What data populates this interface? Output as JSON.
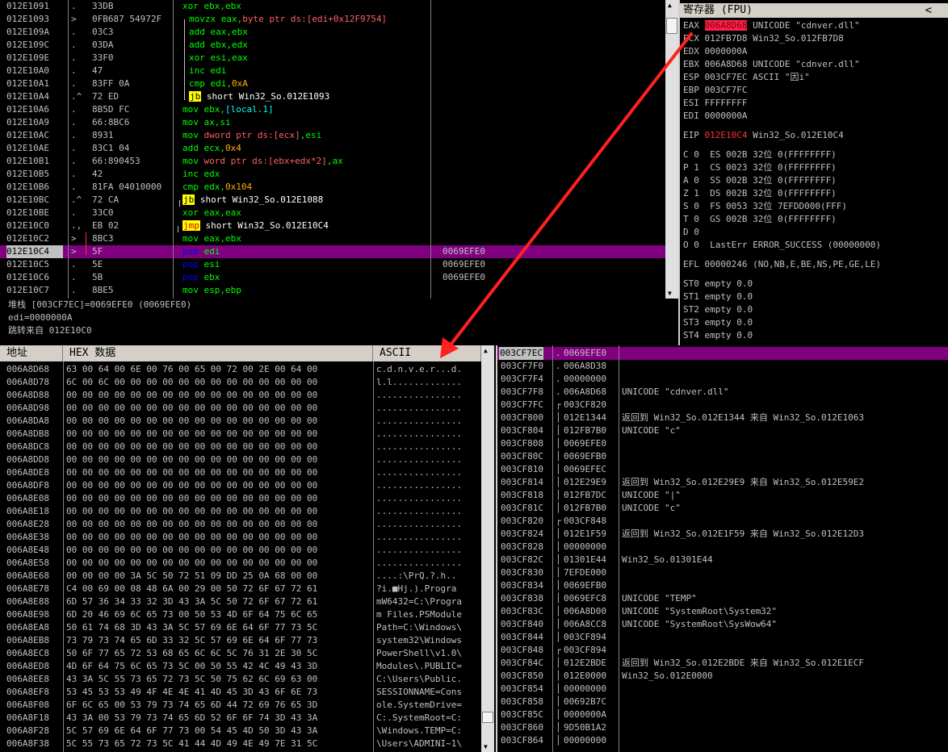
{
  "disasm": [
    {
      "addr": "012E1091",
      "mark": ".",
      "hex": "33DB",
      "asm": [
        [
          "xor",
          "t-xor"
        ],
        [
          " ebx,ebx",
          "t-reg"
        ]
      ],
      "cmt": "",
      "indent": false
    },
    {
      "addr": "012E1093",
      "mark": ">",
      "hex": "0FB687 54972F",
      "asm": [
        [
          "movzx",
          "t-movzx"
        ],
        [
          " eax,",
          "t-reg"
        ],
        [
          "byte ptr ds:[edi+0x12F9754]",
          "t-ptr"
        ]
      ],
      "cmt": "",
      "indent": true
    },
    {
      "addr": "012E109A",
      "mark": ".",
      "hex": "03C3",
      "asm": [
        [
          "add",
          "t-add"
        ],
        [
          " eax,ebx",
          "t-reg"
        ]
      ],
      "cmt": "",
      "indent": true
    },
    {
      "addr": "012E109C",
      "mark": ".",
      "hex": "03DA",
      "asm": [
        [
          "add",
          "t-add"
        ],
        [
          " ebx,edx",
          "t-reg"
        ]
      ],
      "cmt": "",
      "indent": true
    },
    {
      "addr": "012E109E",
      "mark": ".",
      "hex": "33F0",
      "asm": [
        [
          "xor",
          "t-xor"
        ],
        [
          " esi,eax",
          "t-reg"
        ]
      ],
      "cmt": "",
      "indent": true
    },
    {
      "addr": "012E10A0",
      "mark": ".",
      "hex": "47",
      "asm": [
        [
          "inc",
          "t-inc"
        ],
        [
          " edi",
          "t-reg"
        ]
      ],
      "cmt": "",
      "indent": true
    },
    {
      "addr": "012E10A1",
      "mark": ".",
      "hex": "83FF 0A",
      "asm": [
        [
          "cmp",
          "t-cmp"
        ],
        [
          " edi,",
          "t-reg"
        ],
        [
          "0xA",
          "t-imm"
        ]
      ],
      "cmt": "",
      "indent": true
    },
    {
      "addr": "012E10A4",
      "mark": ".^",
      "hex": "72 ED",
      "asm": [
        [
          "jb",
          "jbox"
        ],
        [
          " short Win32_So.012E1093",
          "t-label"
        ]
      ],
      "cmt": "",
      "indent": true
    },
    {
      "addr": "012E10A6",
      "mark": ".",
      "hex": "8B5D FC",
      "asm": [
        [
          "mov",
          "t-mov"
        ],
        [
          " ebx,",
          "t-reg"
        ],
        [
          "[local.1]",
          "t-mem"
        ]
      ],
      "cmt": "",
      "indent": false
    },
    {
      "addr": "012E10A9",
      "mark": ".",
      "hex": "66:8BC6",
      "asm": [
        [
          "mov",
          "t-mov"
        ],
        [
          " ax,si",
          "t-reg"
        ]
      ],
      "cmt": "",
      "indent": false
    },
    {
      "addr": "012E10AC",
      "mark": ".",
      "hex": "8931",
      "asm": [
        [
          "mov",
          "t-mov"
        ],
        [
          " dword ptr ds:[ecx]",
          "t-ptr"
        ],
        [
          ",esi",
          "t-reg"
        ]
      ],
      "cmt": "",
      "indent": false
    },
    {
      "addr": "012E10AE",
      "mark": ".",
      "hex": "83C1 04",
      "asm": [
        [
          "add",
          "t-add"
        ],
        [
          " ecx,",
          "t-reg"
        ],
        [
          "0x4",
          "t-imm"
        ]
      ],
      "cmt": "",
      "indent": false
    },
    {
      "addr": "012E10B1",
      "mark": ".",
      "hex": "66:890453",
      "asm": [
        [
          "mov",
          "t-mov"
        ],
        [
          " word ptr ds:[ebx+edx*2]",
          "t-ptr"
        ],
        [
          ",ax",
          "t-reg"
        ]
      ],
      "cmt": "",
      "indent": false
    },
    {
      "addr": "012E10B5",
      "mark": ".",
      "hex": "42",
      "asm": [
        [
          "inc",
          "t-inc"
        ],
        [
          " edx",
          "t-reg"
        ]
      ],
      "cmt": "",
      "indent": false
    },
    {
      "addr": "012E10B6",
      "mark": ".",
      "hex": "81FA 04010000",
      "asm": [
        [
          "cmp",
          "t-cmp"
        ],
        [
          " edx,",
          "t-reg"
        ],
        [
          "0x104",
          "t-imm"
        ]
      ],
      "cmt": "",
      "indent": false
    },
    {
      "addr": "012E10BC",
      "mark": ".^",
      "hex": "72 CA",
      "asm": [
        [
          "jb",
          "jbox"
        ],
        [
          " short Win32_So.012E1088",
          "t-label"
        ]
      ],
      "cmt": "",
      "indent": false
    },
    {
      "addr": "012E10BE",
      "mark": ".",
      "hex": "33C0",
      "asm": [
        [
          "xor",
          "t-xor"
        ],
        [
          " eax,eax",
          "t-reg"
        ]
      ],
      "cmt": "",
      "indent": false
    },
    {
      "addr": "012E10C0",
      "mark": ".,",
      "hex": "EB 02",
      "asm": [
        [
          "jmp",
          "jmpbox"
        ],
        [
          " short Win32_So.012E10C4",
          "t-label"
        ]
      ],
      "cmt": "",
      "indent": false
    },
    {
      "addr": "012E10C2",
      "mark": ">",
      "hex": "8BC3",
      "asm": [
        [
          "mov",
          "t-mov"
        ],
        [
          " eax,ebx",
          "t-reg"
        ]
      ],
      "cmt": "",
      "indent": false
    },
    {
      "addr": "012E10C4",
      "mark": ">",
      "hex": "5F",
      "asm": [
        [
          "pop",
          "t-pop"
        ],
        [
          " edi",
          "t-reg"
        ]
      ],
      "cmt": "0069EFE0",
      "indent": false,
      "selected": true
    },
    {
      "addr": "012E10C5",
      "mark": ".",
      "hex": "5E",
      "asm": [
        [
          "pop",
          "t-pop"
        ],
        [
          " esi",
          "t-reg"
        ]
      ],
      "cmt": "0069EFE0",
      "indent": false
    },
    {
      "addr": "012E10C6",
      "mark": ".",
      "hex": "5B",
      "asm": [
        [
          "pop",
          "t-pop"
        ],
        [
          " ebx",
          "t-reg"
        ]
      ],
      "cmt": "0069EFE0",
      "indent": false
    },
    {
      "addr": "012E10C7",
      "mark": ".",
      "hex": "8BE5",
      "asm": [
        [
          "mov",
          "t-mov"
        ],
        [
          " esp,ebp",
          "t-reg"
        ]
      ],
      "cmt": "",
      "indent": false
    }
  ],
  "info": {
    "line1": "堆栈 [003CF7EC]=0069EFE0 (0069EFE0)",
    "line2": "edi=0000000A",
    "line3": "跳转来自 012E10C0"
  },
  "registers": {
    "title": "寄存器 (FPU)",
    "collapse": "<",
    "general": [
      {
        "name": "EAX",
        "value": "006A8D68",
        "comment": "UNICODE \"cdnver.dll\"",
        "highlight": true
      },
      {
        "name": "ECX",
        "value": "012FB7D8",
        "comment": "Win32_So.012FB7D8"
      },
      {
        "name": "EDX",
        "value": "0000000A",
        "comment": ""
      },
      {
        "name": "EBX",
        "value": "006A8D68",
        "comment": "UNICODE \"cdnver.dll\""
      },
      {
        "name": "ESP",
        "value": "003CF7EC",
        "comment": "ASCII \"因i\""
      },
      {
        "name": "EBP",
        "value": "003CF7FC",
        "comment": ""
      },
      {
        "name": "ESI",
        "value": "FFFFFFFF",
        "comment": ""
      },
      {
        "name": "EDI",
        "value": "0000000A",
        "comment": ""
      }
    ],
    "eip": {
      "name": "EIP",
      "value": "012E10C4",
      "comment": "Win32_So.012E10C4"
    },
    "flags": [
      "C 0  ES 002B 32位 0(FFFFFFFF)",
      "P 1  CS 0023 32位 0(FFFFFFFF)",
      "A 0  SS 002B 32位 0(FFFFFFFF)",
      "Z 1  DS 002B 32位 0(FFFFFFFF)",
      "S 0  FS 0053 32位 7EFDD000(FFF)",
      "T 0  GS 002B 32位 0(FFFFFFFF)",
      "D 0",
      "O 0  LastErr ERROR_SUCCESS (00000000)"
    ],
    "efl": "EFL 00000246 (NO,NB,E,BE,NS,PE,GE,LE)",
    "fpu": [
      "ST0 empty 0.0",
      "ST1 empty 0.0",
      "ST2 empty 0.0",
      "ST3 empty 0.0",
      "ST4 empty 0.0"
    ]
  },
  "dump": {
    "header": {
      "addr": "地址",
      "hex": "HEX 数据",
      "ascii": "ASCII"
    },
    "rows": [
      {
        "addr": "006A8D68",
        "hex": "63 00 64 00 6E 00 76 00 65 00 72 00 2E 00 64 00",
        "ascii": "c.d.n.v.e.r...d."
      },
      {
        "addr": "006A8D78",
        "hex": "6C 00 6C 00 00 00 00 00 00 00 00 00 00 00 00 00",
        "ascii": "l.l............."
      },
      {
        "addr": "006A8D88",
        "hex": "00 00 00 00 00 00 00 00 00 00 00 00 00 00 00 00",
        "ascii": "................"
      },
      {
        "addr": "006A8D98",
        "hex": "00 00 00 00 00 00 00 00 00 00 00 00 00 00 00 00",
        "ascii": "................"
      },
      {
        "addr": "006A8DA8",
        "hex": "00 00 00 00 00 00 00 00 00 00 00 00 00 00 00 00",
        "ascii": "................"
      },
      {
        "addr": "006A8DB8",
        "hex": "00 00 00 00 00 00 00 00 00 00 00 00 00 00 00 00",
        "ascii": "................"
      },
      {
        "addr": "006A8DC8",
        "hex": "00 00 00 00 00 00 00 00 00 00 00 00 00 00 00 00",
        "ascii": "................"
      },
      {
        "addr": "006A8DD8",
        "hex": "00 00 00 00 00 00 00 00 00 00 00 00 00 00 00 00",
        "ascii": "................"
      },
      {
        "addr": "006A8DE8",
        "hex": "00 00 00 00 00 00 00 00 00 00 00 00 00 00 00 00",
        "ascii": "................"
      },
      {
        "addr": "006A8DF8",
        "hex": "00 00 00 00 00 00 00 00 00 00 00 00 00 00 00 00",
        "ascii": "................"
      },
      {
        "addr": "006A8E08",
        "hex": "00 00 00 00 00 00 00 00 00 00 00 00 00 00 00 00",
        "ascii": "................"
      },
      {
        "addr": "006A8E18",
        "hex": "00 00 00 00 00 00 00 00 00 00 00 00 00 00 00 00",
        "ascii": "................"
      },
      {
        "addr": "006A8E28",
        "hex": "00 00 00 00 00 00 00 00 00 00 00 00 00 00 00 00",
        "ascii": "................"
      },
      {
        "addr": "006A8E38",
        "hex": "00 00 00 00 00 00 00 00 00 00 00 00 00 00 00 00",
        "ascii": "................"
      },
      {
        "addr": "006A8E48",
        "hex": "00 00 00 00 00 00 00 00 00 00 00 00 00 00 00 00",
        "ascii": "................"
      },
      {
        "addr": "006A8E58",
        "hex": "00 00 00 00 00 00 00 00 00 00 00 00 00 00 00 00",
        "ascii": "................"
      },
      {
        "addr": "006A8E68",
        "hex": "00 00 00 00 3A 5C 50 72 51 09 DD 25 0A 68 00 00",
        "ascii": "....:\\PrQ.?.h.."
      },
      {
        "addr": "006A8E78",
        "hex": "C4 00 69 00 08 48 6A 00 29 00 50 72 6F 67 72 61",
        "ascii": "?i.■Hj.).Progra"
      },
      {
        "addr": "006A8E88",
        "hex": "6D 57 36 34 33 32 3D 43 3A 5C 50 72 6F 67 72 61",
        "ascii": "mW6432=C:\\Progra"
      },
      {
        "addr": "006A8E98",
        "hex": "6D 20 46 69 6C 65 73 00 50 53 4D 6F 64 75 6C 65",
        "ascii": "m Files.PSModule"
      },
      {
        "addr": "006A8EA8",
        "hex": "50 61 74 68 3D 43 3A 5C 57 69 6E 64 6F 77 73 5C",
        "ascii": "Path=C:\\Windows\\"
      },
      {
        "addr": "006A8EB8",
        "hex": "73 79 73 74 65 6D 33 32 5C 57 69 6E 64 6F 77 73",
        "ascii": "system32\\Windows"
      },
      {
        "addr": "006A8EC8",
        "hex": "50 6F 77 65 72 53 68 65 6C 6C 5C 76 31 2E 30 5C",
        "ascii": "PowerShell\\v1.0\\"
      },
      {
        "addr": "006A8ED8",
        "hex": "4D 6F 64 75 6C 65 73 5C 00 50 55 42 4C 49 43 3D",
        "ascii": "Modules\\.PUBLIC="
      },
      {
        "addr": "006A8EE8",
        "hex": "43 3A 5C 55 73 65 72 73 5C 50 75 62 6C 69 63 00",
        "ascii": "C:\\Users\\Public."
      },
      {
        "addr": "006A8EF8",
        "hex": "53 45 53 53 49 4F 4E 4E 41 4D 45 3D 43 6F 6E 73",
        "ascii": "SESSIONNAME=Cons"
      },
      {
        "addr": "006A8F08",
        "hex": "6F 6C 65 00 53 79 73 74 65 6D 44 72 69 76 65 3D",
        "ascii": "ole.SystemDrive="
      },
      {
        "addr": "006A8F18",
        "hex": "43 3A 00 53 79 73 74 65 6D 52 6F 6F 74 3D 43 3A",
        "ascii": "C:.SystemRoot=C:"
      },
      {
        "addr": "006A8F28",
        "hex": "5C 57 69 6E 64 6F 77 73 00 54 45 4D 50 3D 43 3A",
        "ascii": "\\Windows.TEMP=C:"
      },
      {
        "addr": "006A8F38",
        "hex": "5C 55 73 65 72 73 5C 41 44 4D 49 4E 49 7E 31 5C",
        "ascii": "\\Users\\ADMINI~1\\"
      }
    ]
  },
  "stack": [
    {
      "addr": "003CF7EC",
      "dot": ".",
      "val": "0069EFE0",
      "cmt": "",
      "selected": true
    },
    {
      "addr": "003CF7F0",
      "dot": ".",
      "val": "006A8D38",
      "cmt": ""
    },
    {
      "addr": "003CF7F4",
      "dot": ".",
      "val": "00000000",
      "cmt": ""
    },
    {
      "addr": "003CF7F8",
      "dot": ".",
      "val": "006A8D68",
      "cmt": "UNICODE \"cdnver.dll\""
    },
    {
      "addr": "003CF7FC",
      "dot": "┌",
      "val": "003CF820",
      "cmt": ""
    },
    {
      "addr": "003CF800",
      "dot": "│",
      "val": "012E1344",
      "cmt": "返回到 Win32_So.012E1344 来自 Win32_So.012E1063"
    },
    {
      "addr": "003CF804",
      "dot": "│",
      "val": "012FB7B0",
      "cmt": "UNICODE \"c\""
    },
    {
      "addr": "003CF808",
      "dot": "│",
      "val": "0069EFE0",
      "cmt": ""
    },
    {
      "addr": "003CF80C",
      "dot": "│",
      "val": "0069EFB0",
      "cmt": ""
    },
    {
      "addr": "003CF810",
      "dot": "│",
      "val": "0069EFEC",
      "cmt": ""
    },
    {
      "addr": "003CF814",
      "dot": "│",
      "val": "012E29E9",
      "cmt": "返回到 Win32_So.012E29E9 来自 Win32_So.012E59E2"
    },
    {
      "addr": "003CF818",
      "dot": "│",
      "val": "012FB7DC",
      "cmt": "UNICODE \"|\""
    },
    {
      "addr": "003CF81C",
      "dot": "│",
      "val": "012FB7B0",
      "cmt": "UNICODE \"c\""
    },
    {
      "addr": "003CF820",
      "dot": "┌",
      "val": "003CF848",
      "cmt": ""
    },
    {
      "addr": "003CF824",
      "dot": "│",
      "val": "012E1F59",
      "cmt": "返回到 Win32_So.012E1F59 来自 Win32_So.012E12D3"
    },
    {
      "addr": "003CF828",
      "dot": "│",
      "val": "00000000",
      "cmt": ""
    },
    {
      "addr": "003CF82C",
      "dot": "│",
      "val": "01301E44",
      "cmt": "Win32_So.01301E44"
    },
    {
      "addr": "003CF830",
      "dot": "│",
      "val": "7EFDE000",
      "cmt": ""
    },
    {
      "addr": "003CF834",
      "dot": "│",
      "val": "0069EFB0",
      "cmt": ""
    },
    {
      "addr": "003CF838",
      "dot": "│",
      "val": "0069EFC8",
      "cmt": "UNICODE \"TEMP\""
    },
    {
      "addr": "003CF83C",
      "dot": "│",
      "val": "006A8D00",
      "cmt": "UNICODE \"SystemRoot\\System32\""
    },
    {
      "addr": "003CF840",
      "dot": "│",
      "val": "006A8CC8",
      "cmt": "UNICODE \"SystemRoot\\SysWow64\""
    },
    {
      "addr": "003CF844",
      "dot": "│",
      "val": "003CF894",
      "cmt": ""
    },
    {
      "addr": "003CF848",
      "dot": "┌",
      "val": "003CF894",
      "cmt": ""
    },
    {
      "addr": "003CF84C",
      "dot": "│",
      "val": "012E2BDE",
      "cmt": "返回到 Win32_So.012E2BDE 来自 Win32_So.012E1ECF"
    },
    {
      "addr": "003CF850",
      "dot": "│",
      "val": "012E0000",
      "cmt": "Win32_So.012E0000"
    },
    {
      "addr": "003CF854",
      "dot": "│",
      "val": "00000000",
      "cmt": ""
    },
    {
      "addr": "003CF858",
      "dot": "│",
      "val": "00692B7C",
      "cmt": ""
    },
    {
      "addr": "003CF85C",
      "dot": "│",
      "val": "0000000A",
      "cmt": ""
    },
    {
      "addr": "003CF860",
      "dot": "│",
      "val": "9D50B1A2",
      "cmt": ""
    },
    {
      "addr": "003CF864",
      "dot": "│",
      "val": "00000000",
      "cmt": ""
    }
  ],
  "colors": {
    "selection": "#800080",
    "arrow": "#ff2020",
    "highlight": "#ff2050"
  }
}
